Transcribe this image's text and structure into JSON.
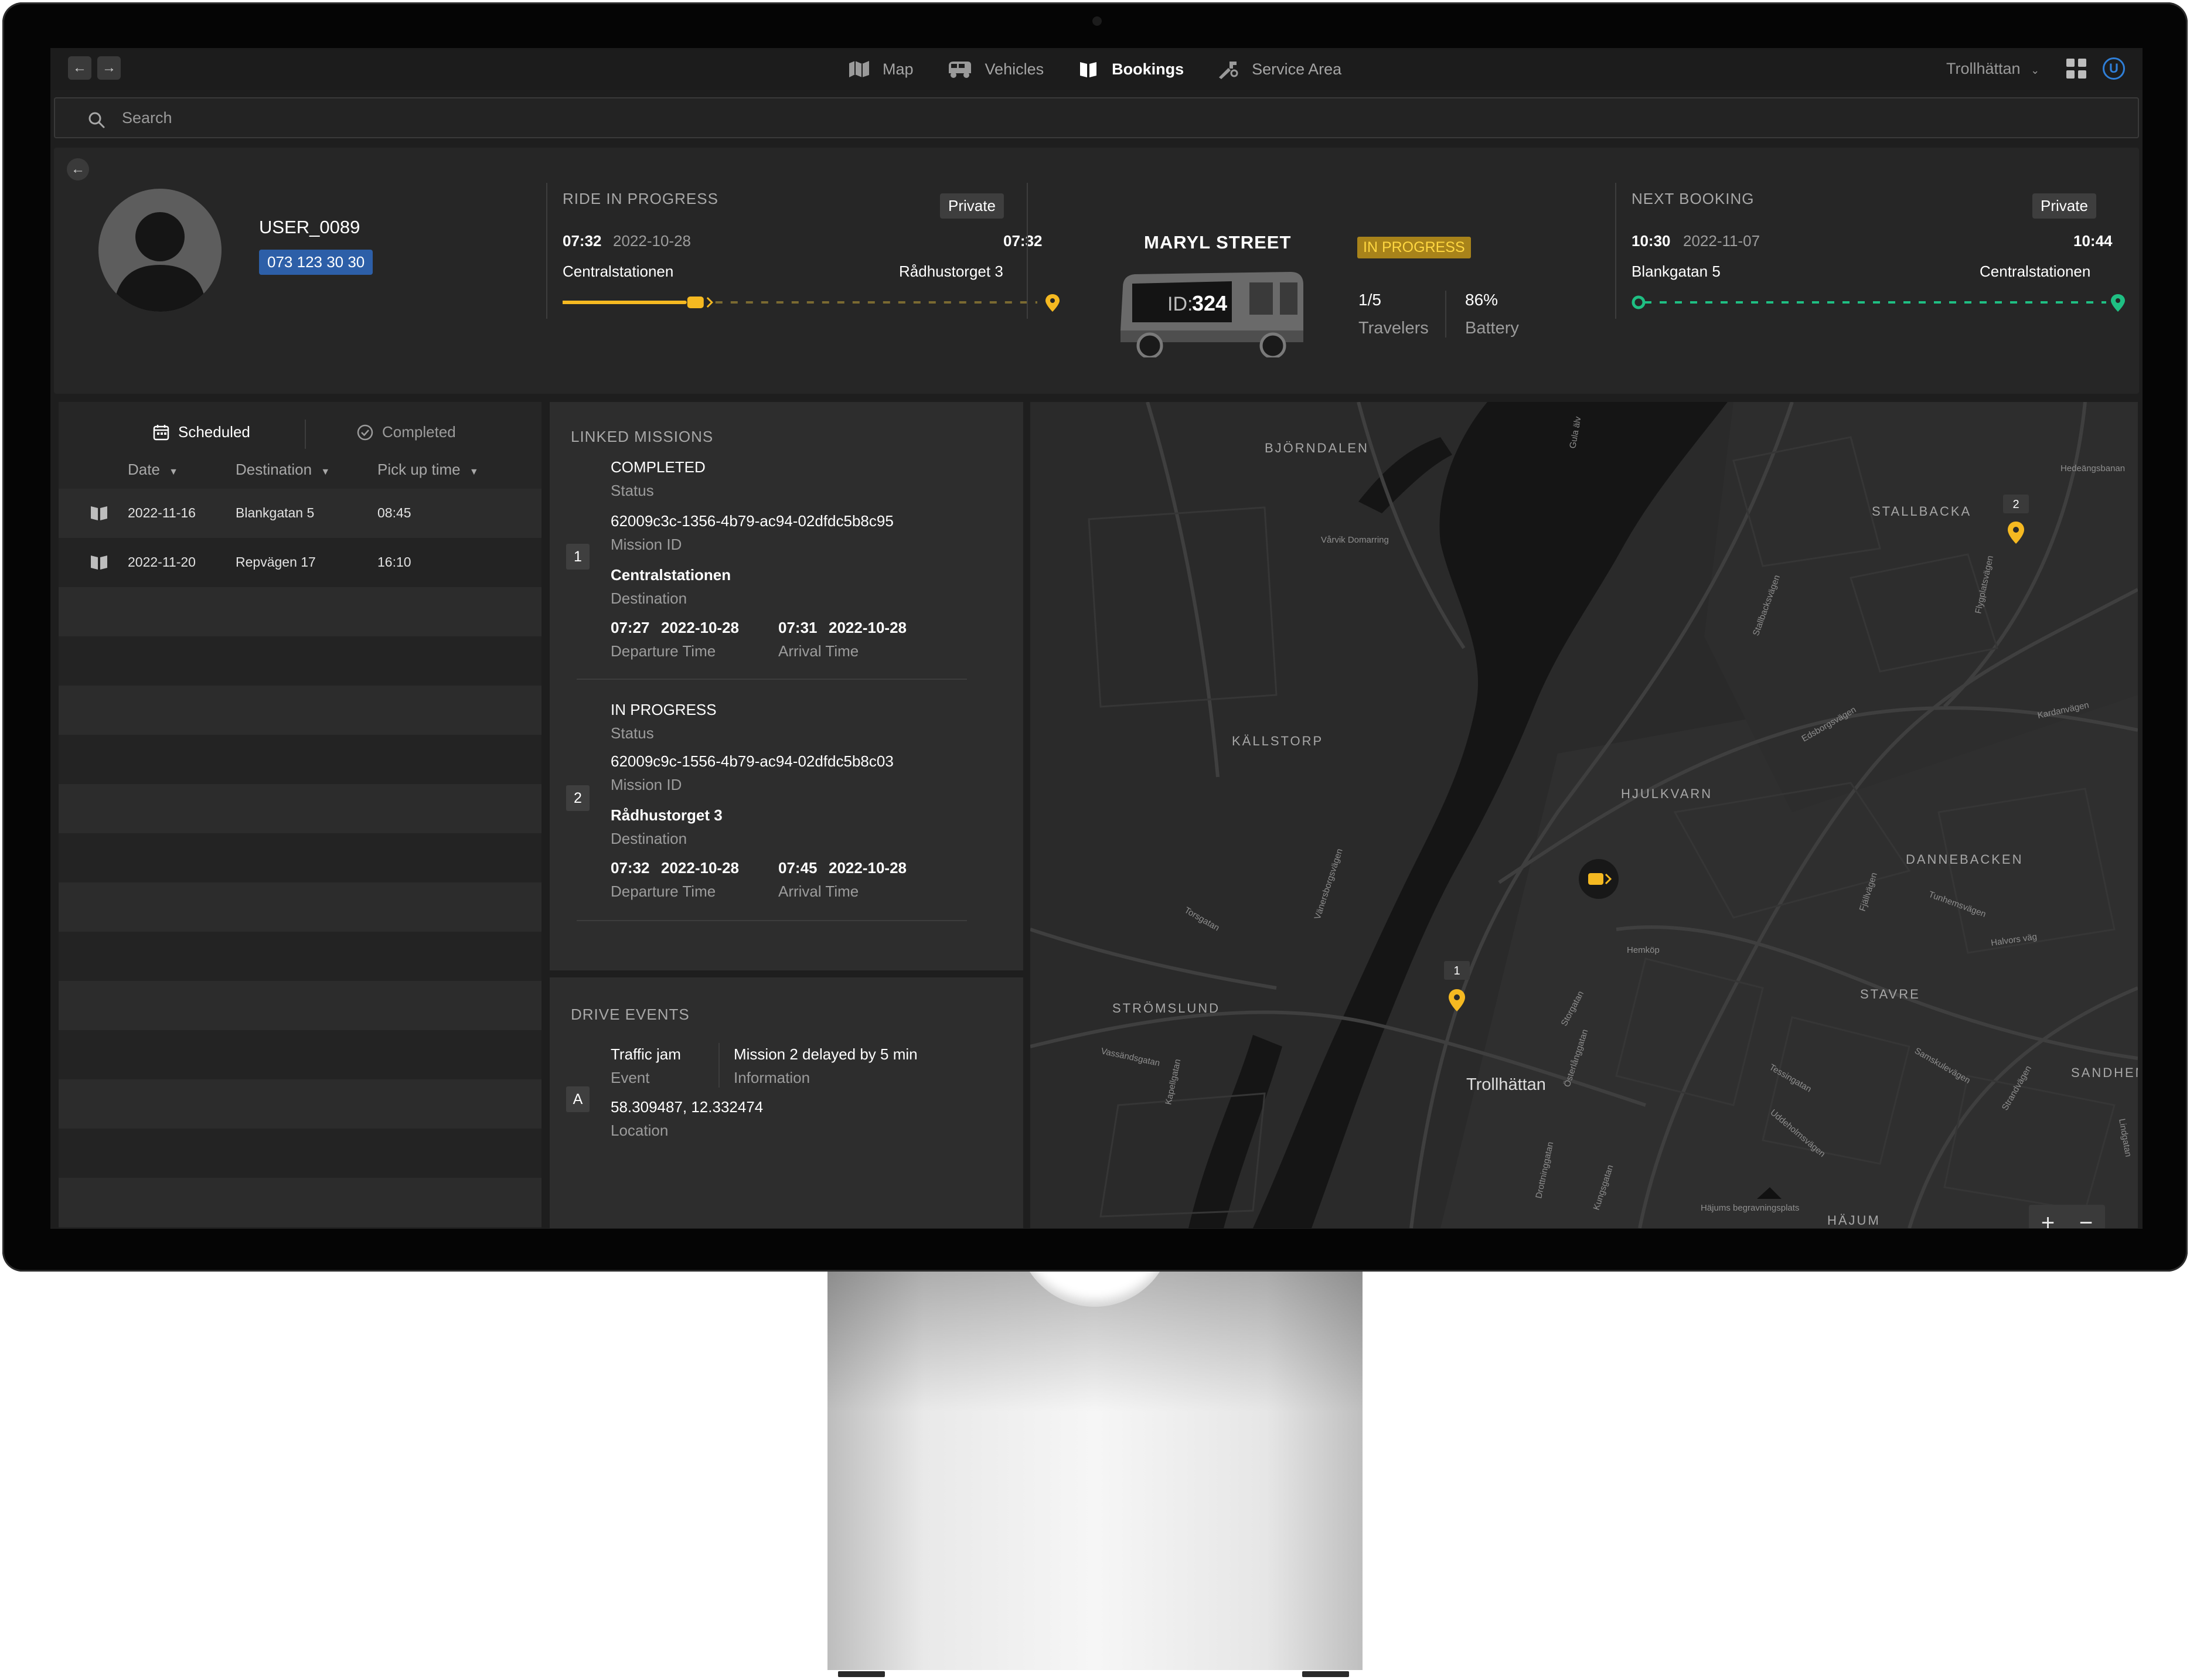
{
  "nav": {
    "tabs": [
      {
        "label": "Map",
        "icon": "map-icon"
      },
      {
        "label": "Vehicles",
        "icon": "vehicle-icon"
      },
      {
        "label": "Bookings",
        "icon": "book-icon",
        "active": true
      },
      {
        "label": "Service Area",
        "icon": "service-area-icon"
      }
    ],
    "city": "Trollhättan",
    "user_initial": "U"
  },
  "search": {
    "placeholder": "Search"
  },
  "user": {
    "name": "USER_0089",
    "phone": "073 123 30 30"
  },
  "ride_in_progress": {
    "title": "RIDE IN PROGRESS",
    "type": "Private",
    "start_time": "07:32",
    "start_date": "2022-10-28",
    "end_time": "07:32",
    "from": "Centralstationen",
    "to": "Rådhustorget 3",
    "progress": 0.28,
    "accent": "#f5b921"
  },
  "vehicle": {
    "street": "MARYL STREET",
    "id_prefix": "ID:",
    "id": "324",
    "status": "IN PROGRESS",
    "travelers": "1/5",
    "travelers_label": "Travelers",
    "battery": "86%",
    "battery_label": "Battery"
  },
  "next_booking": {
    "title": "NEXT BOOKING",
    "type": "Private",
    "start_time": "10:30",
    "start_date": "2022-11-07",
    "end_time": "10:44",
    "from": "Blankgatan 5",
    "to": "Centralstationen",
    "accent": "#1fbf83"
  },
  "bookings": {
    "tab_scheduled": "Scheduled",
    "tab_completed": "Completed",
    "columns": [
      "Date",
      "Destination",
      "Pick up time"
    ],
    "rows": [
      {
        "date": "2022-11-16",
        "destination": "Blankgatan 5",
        "time": "08:45"
      },
      {
        "date": "2022-11-20",
        "destination": "Repvägen 17",
        "time": "16:10"
      }
    ]
  },
  "linked_missions": {
    "title": "LINKED MISSIONS",
    "items": [
      {
        "n": "1",
        "status": "COMPLETED",
        "status_label": "Status",
        "id": "62009c3c-1356-4b79-ac94-02dfdc5b8c95",
        "id_label": "Mission ID",
        "destination": "Centralstationen",
        "destination_label": "Destination",
        "dep_time": "07:27",
        "dep_date": "2022-10-28",
        "dep_label": "Departure Time",
        "arr_time": "07:31",
        "arr_date": "2022-10-28",
        "arr_label": "Arrival Time"
      },
      {
        "n": "2",
        "status": "IN PROGRESS",
        "status_label": "Status",
        "id": "62009c9c-1556-4b79-ac94-02dfdc5b8c03",
        "id_label": "Mission ID",
        "destination": "Rådhustorget 3",
        "destination_label": "Destination",
        "dep_time": "07:32",
        "dep_date": "2022-10-28",
        "dep_label": "Departure Time",
        "arr_time": "07:45",
        "arr_date": "2022-10-28",
        "arr_label": "Arrival Time"
      }
    ]
  },
  "drive_events": {
    "title": "DRIVE EVENTS",
    "items": [
      {
        "n": "A",
        "event": "Traffic jam",
        "event_label": "Event",
        "info": "Mission 2 delayed by 5 min",
        "info_label": "Information",
        "location": "58.309487, 12.332474",
        "location_label": "Location"
      }
    ]
  },
  "map": {
    "districts": [
      "BJÖRNDALEN",
      "STALLBACKA",
      "KÄLLSTORP",
      "HJULKVARN",
      "DANNEBACKEN",
      "STAVRE",
      "STRÖMSLUND",
      "SANDHEM",
      "HÄJUM"
    ],
    "city": "Trollhättan",
    "minor_labels": [
      "Vårvik Domarring",
      "Hedeängsbanan",
      "Kardanvägen",
      "Edsborgsvägen",
      "Stallbacksvägen",
      "Flygplatsvägen",
      "Hemköp",
      "Halvors väg",
      "Tunhemsvägen",
      "Fjällvägen",
      "Torsgatan",
      "Vänersborgsvägen",
      "Kapellgatan",
      "Vassändsgatan",
      "Storgatan",
      "Österlånggatan",
      "Drottninggatan",
      "Kungsgatan",
      "Tessingatan",
      "Uddeholmsvägen",
      "Samskulevägen",
      "Strandvägen",
      "Lindgatan",
      "Gula älv",
      "Häjums begravningsplats"
    ],
    "pins": [
      {
        "label": "1"
      },
      {
        "label": "2"
      }
    ],
    "zoom_in": "+",
    "zoom_out": "−",
    "pin_color": "#f5b921"
  }
}
